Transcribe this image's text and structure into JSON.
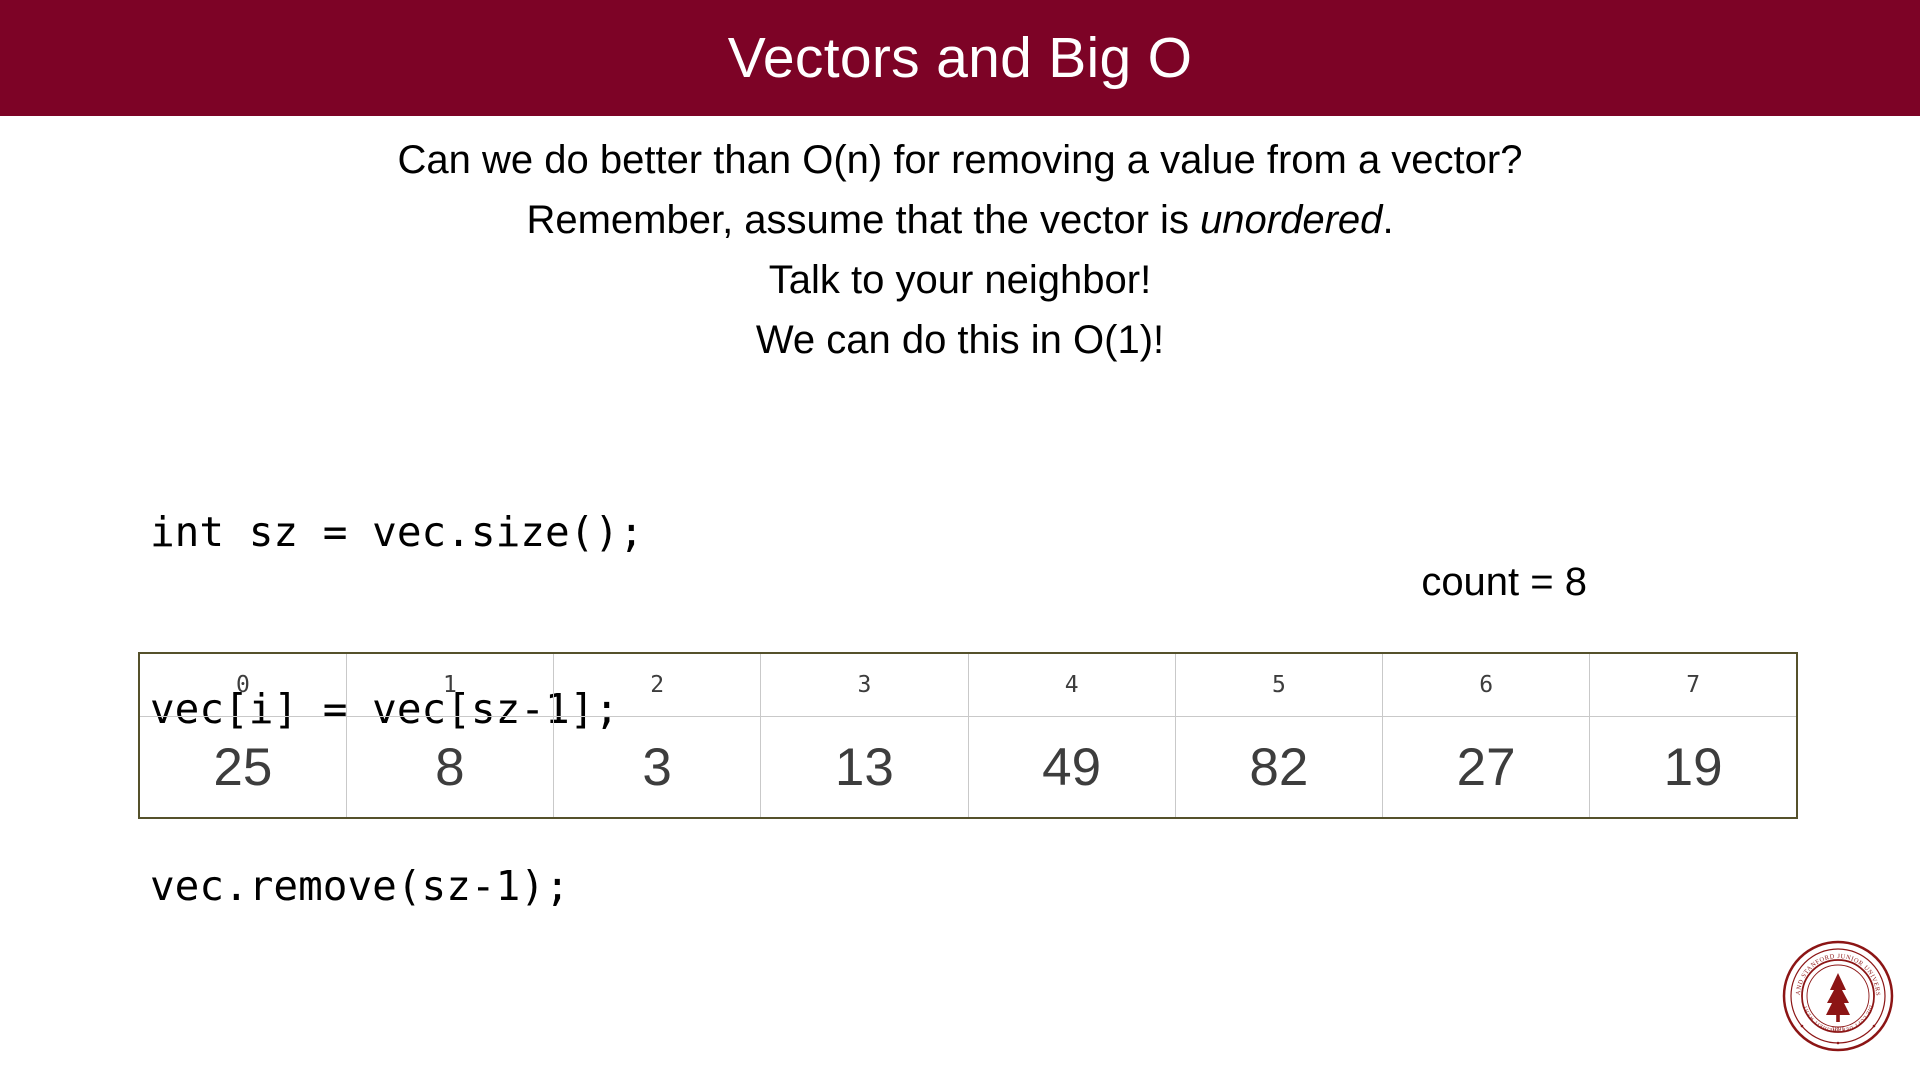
{
  "slide": {
    "title": "Vectors and Big O",
    "title_bar_color": "#7d0326",
    "background_color": "#ffffff",
    "text_color": "#000000"
  },
  "prose": {
    "line1": "Can we do better than O(n) for removing a value from a vector?",
    "line2_before_italic": "Remember, assume that the vector is ",
    "line2_italic": "unordered",
    "line2_after_italic": ".",
    "line3": "Talk to your neighbor!",
    "line4": "We can do this in O(1)!"
  },
  "code": {
    "lines": [
      "int sz = vec.size();",
      "vec[i] = vec[sz-1];",
      "vec.remove(sz-1);"
    ]
  },
  "count": {
    "label": "count = 8"
  },
  "vector_table": {
    "indices": [
      "0",
      "1",
      "2",
      "3",
      "4",
      "5",
      "6",
      "7"
    ],
    "values": [
      "25",
      "8",
      "3",
      "13",
      "49",
      "82",
      "27",
      "19"
    ],
    "border_color": "#55512b",
    "divider_color": "#c9c9c9",
    "text_color": "#3d3d3d"
  },
  "logo": {
    "name": "stanford-seal",
    "color": "#8c1515",
    "outer_text": "LELAND STANFORD JUNIOR UNIVERSITY",
    "inner_text": "DIE LUFT DER FREIHEIT WEHT",
    "year": "1891"
  }
}
